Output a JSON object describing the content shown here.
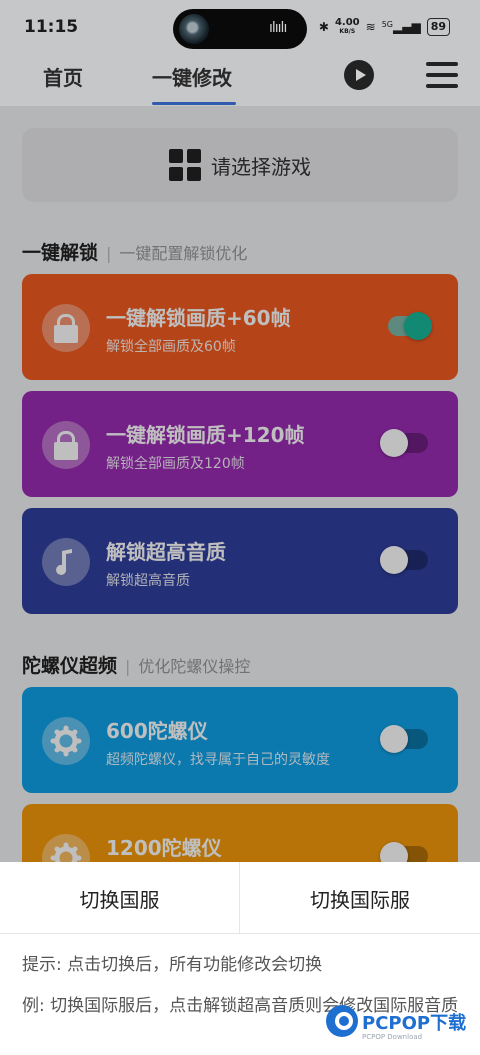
{
  "status_bar": {
    "time": "11:15",
    "speed_value": "4.00",
    "speed_unit": "KB/S",
    "signal_label": "5G",
    "battery": "89"
  },
  "nav": {
    "tabs": [
      {
        "label": "首页",
        "active": false
      },
      {
        "label": "一键修改",
        "active": true
      }
    ],
    "accent_color": "#3b6fd6"
  },
  "game_select": {
    "label": "请选择游戏"
  },
  "sections": [
    {
      "title": "一键解锁",
      "subtitle": "一键配置解锁优化",
      "cards": [
        {
          "title": "一键解锁画质+60帧",
          "desc": "解锁全部画质及60帧",
          "color": "#f25b22",
          "icon": "unlock-icon",
          "enabled": true
        },
        {
          "title": "一键解锁画质+120帧",
          "desc": "解锁全部画质及120帧",
          "color": "#9a2bb4",
          "icon": "unlock-icon",
          "enabled": false
        },
        {
          "title": "解锁超高音质",
          "desc": "解锁超高音质",
          "color": "#2f3f9e",
          "icon": "music-note-icon",
          "enabled": false
        }
      ]
    },
    {
      "title": "陀螺仪超频",
      "subtitle": "优化陀螺仪操控",
      "cards": [
        {
          "title": "600陀螺仪",
          "desc": "超频陀螺仪，找寻属于自己的灵敏度",
          "color": "#10a2e8",
          "icon": "gear-icon",
          "enabled": false
        },
        {
          "title": "1200陀螺仪",
          "desc": "",
          "color": "#f49a0b",
          "icon": "gear-icon",
          "enabled": false
        }
      ]
    }
  ],
  "sheet": {
    "left_button": "切换国服",
    "right_button": "切换国际服",
    "tip1": "提示: 点击切换后，所有功能修改会切换",
    "tip2": "例: 切换国际服后，点击解锁超高音质则会修改国际服音质"
  },
  "watermark": {
    "text": "PCPOP下载",
    "sub": "PCPOP Download"
  }
}
